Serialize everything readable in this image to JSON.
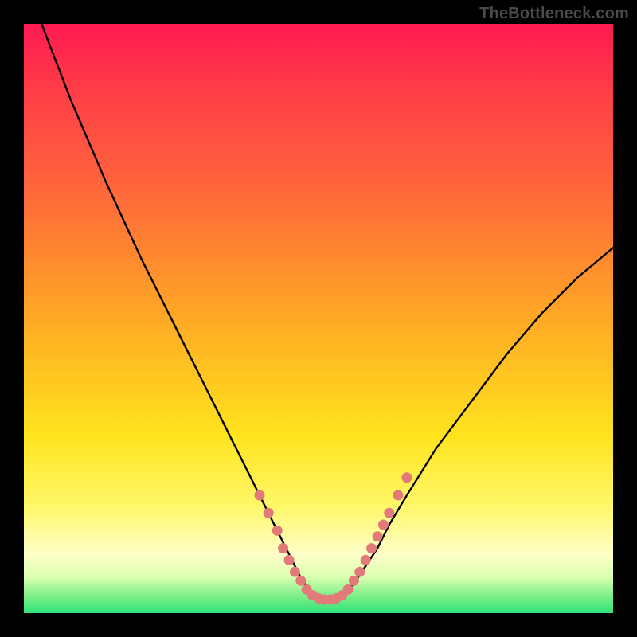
{
  "watermark": "TheBottleneck.com",
  "chart_data": {
    "type": "line",
    "title": "",
    "xlabel": "",
    "ylabel": "",
    "xlim": [
      0,
      100
    ],
    "ylim": [
      0,
      100
    ],
    "series": [
      {
        "name": "curve",
        "x": [
          3,
          8,
          14,
          20,
          26,
          32,
          36,
          40,
          43,
          45,
          47,
          49,
          50,
          52,
          54,
          56,
          58,
          60,
          62,
          65,
          70,
          76,
          82,
          88,
          94,
          100
        ],
        "y": [
          100,
          87,
          73,
          60,
          48,
          36,
          28,
          20,
          14,
          10,
          6,
          3,
          2,
          2,
          3,
          5,
          8,
          11,
          15,
          20,
          28,
          36,
          44,
          51,
          57,
          62
        ]
      }
    ],
    "markers": {
      "name": "dots",
      "color": "#e17a78",
      "points": [
        {
          "x": 40,
          "y": 20
        },
        {
          "x": 41.5,
          "y": 17
        },
        {
          "x": 43,
          "y": 14
        },
        {
          "x": 44,
          "y": 11
        },
        {
          "x": 45,
          "y": 9
        },
        {
          "x": 46,
          "y": 7
        },
        {
          "x": 47,
          "y": 5.5
        },
        {
          "x": 48,
          "y": 4
        },
        {
          "x": 49,
          "y": 3
        },
        {
          "x": 50,
          "y": 2.5
        },
        {
          "x": 51,
          "y": 2.3
        },
        {
          "x": 52,
          "y": 2.3
        },
        {
          "x": 53,
          "y": 2.5
        },
        {
          "x": 54,
          "y": 3
        },
        {
          "x": 55,
          "y": 4
        },
        {
          "x": 56,
          "y": 5.5
        },
        {
          "x": 57,
          "y": 7
        },
        {
          "x": 58,
          "y": 9
        },
        {
          "x": 59,
          "y": 11
        },
        {
          "x": 60,
          "y": 13
        },
        {
          "x": 61,
          "y": 15
        },
        {
          "x": 62,
          "y": 17
        },
        {
          "x": 63.5,
          "y": 20
        },
        {
          "x": 65,
          "y": 23
        }
      ]
    }
  }
}
